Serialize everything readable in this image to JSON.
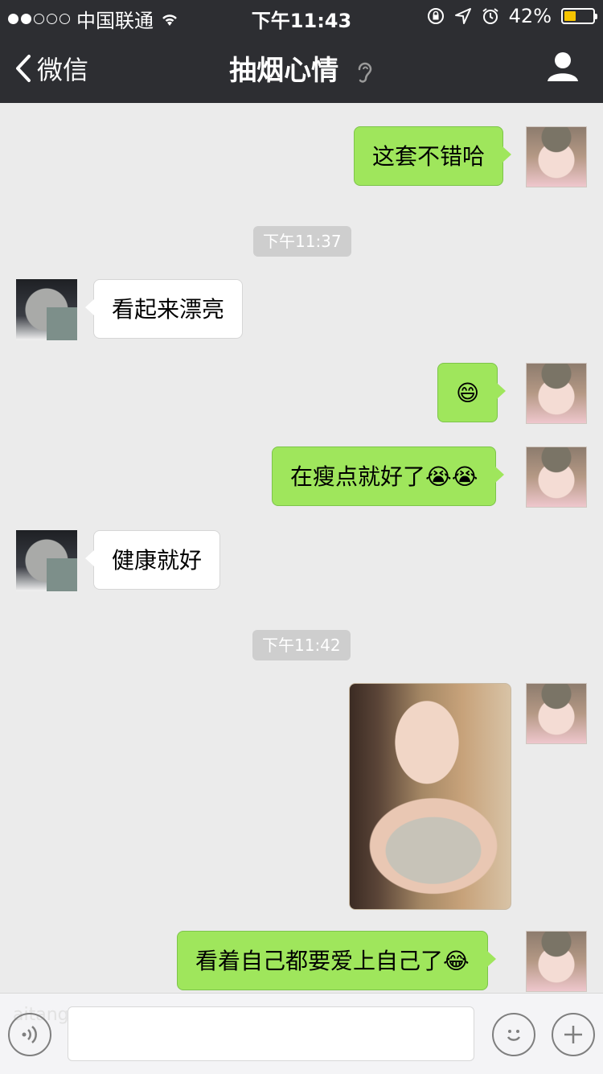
{
  "status_bar": {
    "carrier": "中国联通",
    "time": "下午11:43",
    "battery_percent_text": "42%",
    "battery_level": 0.42
  },
  "nav": {
    "back_label": "微信",
    "title": "抽烟心情"
  },
  "messages": [
    {
      "side": "sent",
      "text": "这套不错哈"
    },
    {
      "type": "time",
      "text": "下午11:37"
    },
    {
      "side": "received",
      "text": "看起来漂亮"
    },
    {
      "side": "sent",
      "text": "😄"
    },
    {
      "side": "sent",
      "text": "在瘦点就好了😭😭"
    },
    {
      "side": "received",
      "text": "健康就好"
    },
    {
      "type": "time",
      "text": "下午11:42"
    },
    {
      "side": "sent",
      "type": "image"
    },
    {
      "side": "sent",
      "text": "看着自己都要爱上自己了😂"
    }
  ],
  "input_bar": {
    "watermark": "aitangtu.com"
  },
  "colors": {
    "header_bg": "#2d2e32",
    "chat_bg": "#ebebeb",
    "sent_bubble": "#9fe65c",
    "received_bubble": "#ffffff",
    "battery_fill": "#f5c400"
  }
}
